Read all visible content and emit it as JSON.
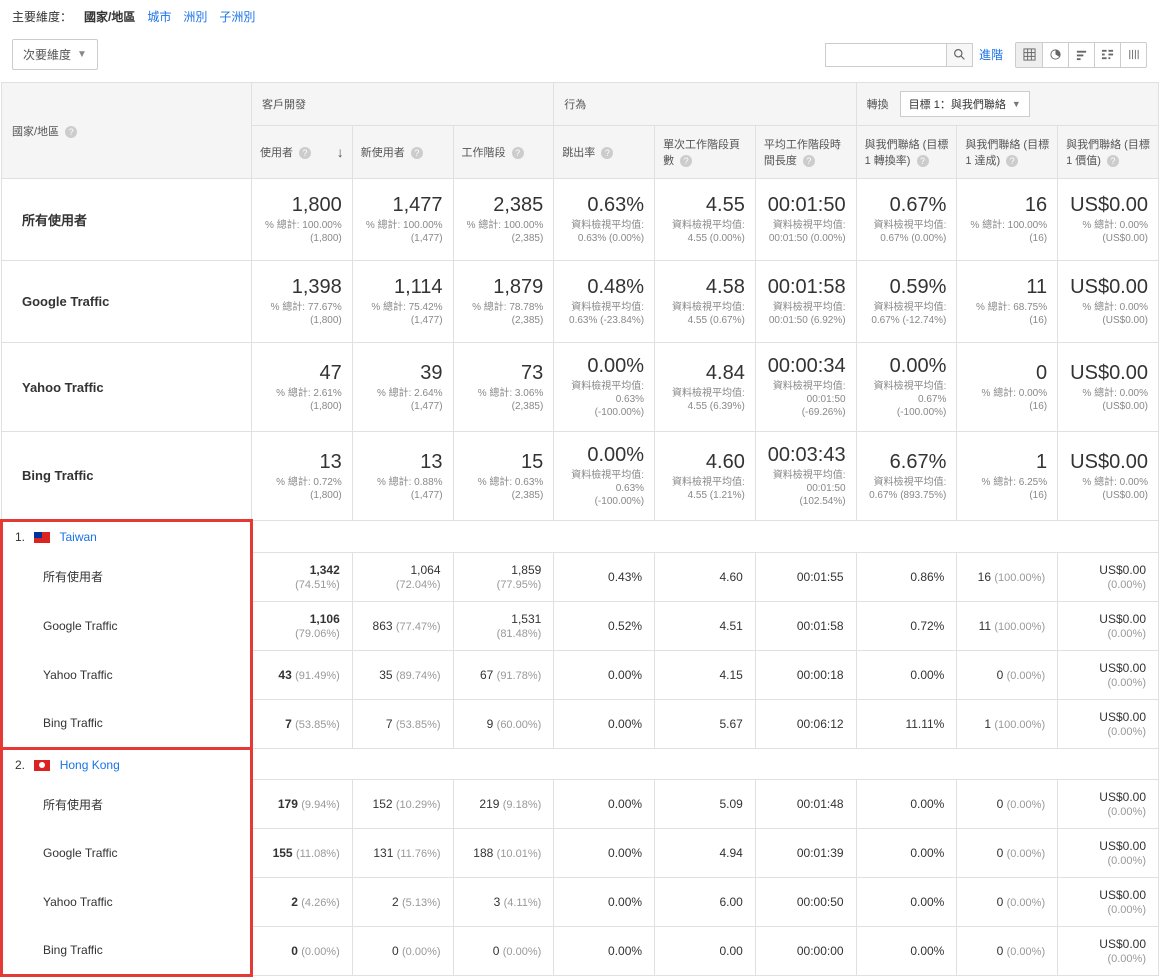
{
  "topbar": {
    "primary_dim_label": "主要維度：",
    "tab_country": "國家/地區",
    "link_city": "城市",
    "link_continent": "洲別",
    "link_subcontinent": "子洲別"
  },
  "controls": {
    "secondary_dim": "次要維度",
    "advanced": "進階"
  },
  "headers": {
    "country": "國家/地區",
    "acquisition": "客戶開發",
    "behavior": "行為",
    "conversions": "轉換",
    "goal_select": "目標 1：與我們聯絡",
    "users": "使用者",
    "new_users": "新使用者",
    "sessions": "工作階段",
    "bounce_rate": "跳出率",
    "pages_session": "單次工作階段頁數",
    "avg_duration": "平均工作階段時間長度",
    "goal_rate": "與我們聯絡 (目標 1 轉換率)",
    "goal_completions": "與我們聯絡 (目標 1 達成)",
    "goal_value": "與我們聯絡 (目標 1 價值)"
  },
  "summary": [
    {
      "label": "所有使用者",
      "users": "1,800",
      "users_sub": "% 總計: 100.00% (1,800)",
      "new_users": "1,477",
      "new_users_sub": "% 總計: 100.00% (1,477)",
      "sessions": "2,385",
      "sessions_sub": "% 總計: 100.00% (2,385)",
      "bounce": "0.63%",
      "bounce_sub": "資料檢視平均值: 0.63% (0.00%)",
      "pages": "4.55",
      "pages_sub": "資料檢視平均值: 4.55 (0.00%)",
      "duration": "00:01:50",
      "duration_sub": "資料檢視平均值: 00:01:50 (0.00%)",
      "goal_rate": "0.67%",
      "goal_rate_sub": "資料檢視平均值: 0.67% (0.00%)",
      "goal_comp": "16",
      "goal_comp_sub": "% 總計: 100.00% (16)",
      "goal_val": "US$0.00",
      "goal_val_sub": "% 總計: 0.00% (US$0.00)"
    },
    {
      "label": "Google Traffic",
      "users": "1,398",
      "users_sub": "% 總計: 77.67% (1,800)",
      "new_users": "1,114",
      "new_users_sub": "% 總計: 75.42% (1,477)",
      "sessions": "1,879",
      "sessions_sub": "% 總計: 78.78% (2,385)",
      "bounce": "0.48%",
      "bounce_sub": "資料檢視平均值: 0.63% (-23.84%)",
      "pages": "4.58",
      "pages_sub": "資料檢視平均值: 4.55 (0.67%)",
      "duration": "00:01:58",
      "duration_sub": "資料檢視平均值: 00:01:50 (6.92%)",
      "goal_rate": "0.59%",
      "goal_rate_sub": "資料檢視平均值: 0.67% (-12.74%)",
      "goal_comp": "11",
      "goal_comp_sub": "% 總計: 68.75% (16)",
      "goal_val": "US$0.00",
      "goal_val_sub": "% 總計: 0.00% (US$0.00)"
    },
    {
      "label": "Yahoo Traffic",
      "users": "47",
      "users_sub": "% 總計: 2.61% (1,800)",
      "new_users": "39",
      "new_users_sub": "% 總計: 2.64% (1,477)",
      "sessions": "73",
      "sessions_sub": "% 總計: 3.06% (2,385)",
      "bounce": "0.00%",
      "bounce_sub": "資料檢視平均值: 0.63% (-100.00%)",
      "pages": "4.84",
      "pages_sub": "資料檢視平均值: 4.55 (6.39%)",
      "duration": "00:00:34",
      "duration_sub": "資料檢視平均值: 00:01:50 (-69.26%)",
      "goal_rate": "0.00%",
      "goal_rate_sub": "資料檢視平均值: 0.67% (-100.00%)",
      "goal_comp": "0",
      "goal_comp_sub": "% 總計: 0.00% (16)",
      "goal_val": "US$0.00",
      "goal_val_sub": "% 總計: 0.00% (US$0.00)"
    },
    {
      "label": "Bing Traffic",
      "users": "13",
      "users_sub": "% 總計: 0.72% (1,800)",
      "new_users": "13",
      "new_users_sub": "% 總計: 0.88% (1,477)",
      "sessions": "15",
      "sessions_sub": "% 總計: 0.63% (2,385)",
      "bounce": "0.00%",
      "bounce_sub": "資料檢視平均值: 0.63% (-100.00%)",
      "pages": "4.60",
      "pages_sub": "資料檢視平均值: 4.55 (1.21%)",
      "duration": "00:03:43",
      "duration_sub": "資料檢視平均值: 00:01:50 (102.54%)",
      "goal_rate": "6.67%",
      "goal_rate_sub": "資料檢視平均值: 0.67% (893.75%)",
      "goal_comp": "1",
      "goal_comp_sub": "% 總計: 6.25% (16)",
      "goal_val": "US$0.00",
      "goal_val_sub": "% 總計: 0.00% (US$0.00)"
    }
  ],
  "countries": [
    {
      "idx": "1.",
      "name": "Taiwan",
      "flag": "tw",
      "rows": [
        {
          "label": "所有使用者",
          "users": "1,342",
          "users_pct": "(74.51%)",
          "new_users": "1,064",
          "new_users_pct": "(72.04%)",
          "sessions": "1,859",
          "sessions_pct": "(77.95%)",
          "bounce": "0.43%",
          "pages": "4.60",
          "duration": "00:01:55",
          "goal_rate": "0.86%",
          "goal_comp": "16",
          "goal_comp_pct": "(100.00%)",
          "goal_val": "US$0.00",
          "goal_val_pct": "(0.00%)"
        },
        {
          "label": "Google Traffic",
          "users": "1,106",
          "users_pct": "(79.06%)",
          "new_users": "863",
          "new_users_pct": "(77.47%)",
          "sessions": "1,531",
          "sessions_pct": "(81.48%)",
          "bounce": "0.52%",
          "pages": "4.51",
          "duration": "00:01:58",
          "goal_rate": "0.72%",
          "goal_comp": "11",
          "goal_comp_pct": "(100.00%)",
          "goal_val": "US$0.00",
          "goal_val_pct": "(0.00%)"
        },
        {
          "label": "Yahoo Traffic",
          "users": "43",
          "users_pct": "(91.49%)",
          "new_users": "35",
          "new_users_pct": "(89.74%)",
          "sessions": "67",
          "sessions_pct": "(91.78%)",
          "bounce": "0.00%",
          "pages": "4.15",
          "duration": "00:00:18",
          "goal_rate": "0.00%",
          "goal_comp": "0",
          "goal_comp_pct": "(0.00%)",
          "goal_val": "US$0.00",
          "goal_val_pct": "(0.00%)"
        },
        {
          "label": "Bing Traffic",
          "users": "7",
          "users_pct": "(53.85%)",
          "new_users": "7",
          "new_users_pct": "(53.85%)",
          "sessions": "9",
          "sessions_pct": "(60.00%)",
          "bounce": "0.00%",
          "pages": "5.67",
          "duration": "00:06:12",
          "goal_rate": "11.11%",
          "goal_comp": "1",
          "goal_comp_pct": "(100.00%)",
          "goal_val": "US$0.00",
          "goal_val_pct": "(0.00%)"
        }
      ]
    },
    {
      "idx": "2.",
      "name": "Hong Kong",
      "flag": "hk",
      "rows": [
        {
          "label": "所有使用者",
          "users": "179",
          "users_pct": "(9.94%)",
          "new_users": "152",
          "new_users_pct": "(10.29%)",
          "sessions": "219",
          "sessions_pct": "(9.18%)",
          "bounce": "0.00%",
          "pages": "5.09",
          "duration": "00:01:48",
          "goal_rate": "0.00%",
          "goal_comp": "0",
          "goal_comp_pct": "(0.00%)",
          "goal_val": "US$0.00",
          "goal_val_pct": "(0.00%)"
        },
        {
          "label": "Google Traffic",
          "users": "155",
          "users_pct": "(11.08%)",
          "new_users": "131",
          "new_users_pct": "(11.76%)",
          "sessions": "188",
          "sessions_pct": "(10.01%)",
          "bounce": "0.00%",
          "pages": "4.94",
          "duration": "00:01:39",
          "goal_rate": "0.00%",
          "goal_comp": "0",
          "goal_comp_pct": "(0.00%)",
          "goal_val": "US$0.00",
          "goal_val_pct": "(0.00%)"
        },
        {
          "label": "Yahoo Traffic",
          "users": "2",
          "users_pct": "(4.26%)",
          "new_users": "2",
          "new_users_pct": "(5.13%)",
          "sessions": "3",
          "sessions_pct": "(4.11%)",
          "bounce": "0.00%",
          "pages": "6.00",
          "duration": "00:00:50",
          "goal_rate": "0.00%",
          "goal_comp": "0",
          "goal_comp_pct": "(0.00%)",
          "goal_val": "US$0.00",
          "goal_val_pct": "(0.00%)"
        },
        {
          "label": "Bing Traffic",
          "users": "0",
          "users_pct": "(0.00%)",
          "new_users": "0",
          "new_users_pct": "(0.00%)",
          "sessions": "0",
          "sessions_pct": "(0.00%)",
          "bounce": "0.00%",
          "pages": "0.00",
          "duration": "00:00:00",
          "goal_rate": "0.00%",
          "goal_comp": "0",
          "goal_comp_pct": "(0.00%)",
          "goal_val": "US$0.00",
          "goal_val_pct": "(0.00%)"
        }
      ]
    }
  ]
}
